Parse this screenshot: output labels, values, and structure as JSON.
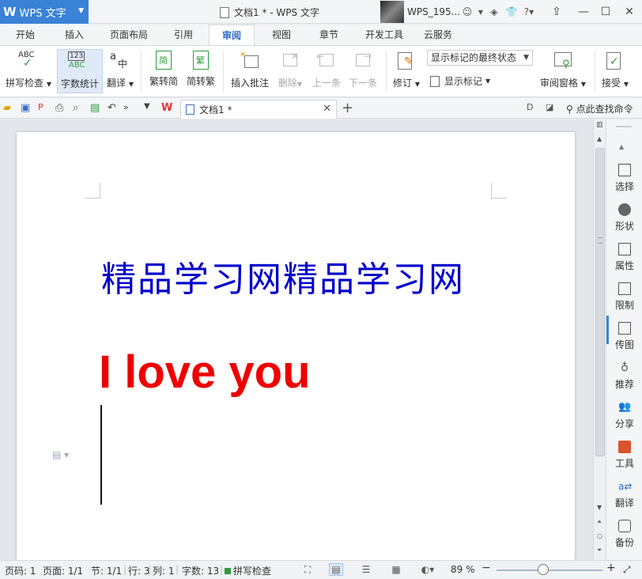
{
  "titlebar": {
    "app_logo": "W",
    "app_name": "WPS 文字",
    "doc_title": "文档1 * - WPS 文字",
    "user_name": "WPS_195...",
    "help": "?"
  },
  "menu": {
    "tabs": [
      "开始",
      "插入",
      "页面布局",
      "引用",
      "审阅",
      "视图",
      "章节",
      "开发工具",
      "云服务"
    ],
    "active": "审阅"
  },
  "ribbon": {
    "spell_check": "拼写检查",
    "word_count": "字数统计",
    "translate": "翻译",
    "trad_to_simp": "繁转简",
    "simp_to_trad": "简转繁",
    "insert_comment": "插入批注",
    "delete": "删除",
    "prev": "上一条",
    "next": "下一条",
    "revise": "修订",
    "markup_state": "显示标记的最终状态",
    "show_markup": "显示标记",
    "review_pane": "审阅窗格",
    "accept": "接受",
    "icon_text": {
      "abc": "ABC",
      "n123": "123",
      "a": "a",
      "zhong": "中",
      "jian": "简",
      "fan": "繁"
    }
  },
  "quickbar": {
    "doc_tab": "文档1 *",
    "find_command": "点此查找命令"
  },
  "document": {
    "line1": "精品学习网精品学习网",
    "line2": "I love you"
  },
  "sidepanel": {
    "items": [
      "选择",
      "形状",
      "属性",
      "限制",
      "传图",
      "推荐",
      "分享",
      "工具",
      "翻译",
      "备份"
    ]
  },
  "statusbar": {
    "page_num": "页码: 1",
    "pages": "页面: 1/1",
    "section": "节: 1/1",
    "row": "行: 3",
    "col": "列: 1",
    "word_count": "字数: 13",
    "spell": "拼写检查",
    "zoom": "89 %",
    "zoom_minus": "−",
    "zoom_plus": "+"
  },
  "colors": {
    "accent": "#3a82d6",
    "line1_color": "#0000cc",
    "line2_color": "#ee0000"
  }
}
